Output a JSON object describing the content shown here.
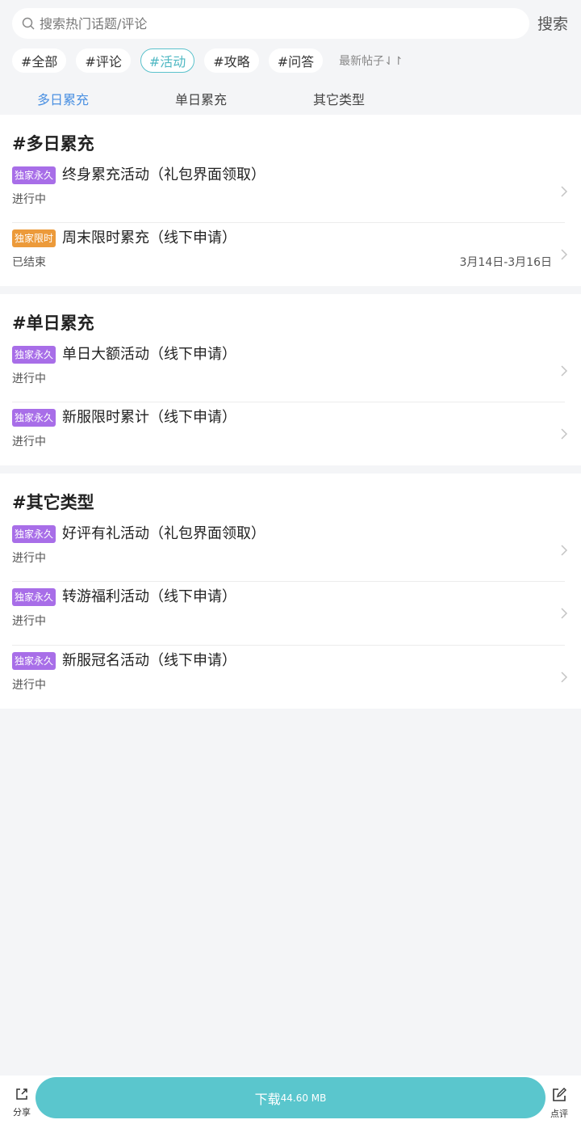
{
  "search": {
    "placeholder": "搜索热门话题/评论",
    "button": "搜索"
  },
  "tags": [
    "#全部",
    "#评论",
    "#活动",
    "#攻略",
    "#问答"
  ],
  "active_tag": "#活动",
  "sort_label": "最新帖子⇃↾",
  "subtabs": [
    "多日累充",
    "单日累充",
    "其它类型"
  ],
  "active_subtab": "多日累充",
  "sections": [
    {
      "title": "#多日累充",
      "items": [
        {
          "badge": "独家永久",
          "badge_color": "#a86ee8",
          "title": "终身累充活动（礼包界面领取）",
          "status": "进行中",
          "date": ""
        },
        {
          "badge": "独家限时",
          "badge_color": "#ec9a3a",
          "title": "周末限时累充（线下申请）",
          "status": "已结束",
          "date": "3月14日-3月16日"
        }
      ]
    },
    {
      "title": "#单日累充",
      "items": [
        {
          "badge": "独家永久",
          "badge_color": "#a86ee8",
          "title": "单日大额活动（线下申请）",
          "status": "进行中",
          "date": ""
        },
        {
          "badge": "独家永久",
          "badge_color": "#a86ee8",
          "title": "新服限时累计（线下申请）",
          "status": "进行中",
          "date": ""
        }
      ]
    },
    {
      "title": "#其它类型",
      "items": [
        {
          "badge": "独家永久",
          "badge_color": "#a86ee8",
          "title": "好评有礼活动（礼包界面领取）",
          "status": "进行中",
          "date": ""
        },
        {
          "badge": "独家永久",
          "badge_color": "#a86ee8",
          "title": "转游福利活动（线下申请）",
          "status": "进行中",
          "date": ""
        },
        {
          "badge": "独家永久",
          "badge_color": "#a86ee8",
          "title": "新服冠名活动（线下申请）",
          "status": "进行中",
          "date": ""
        }
      ]
    }
  ],
  "bottom": {
    "share": "分享",
    "download": "下载",
    "size": "44.60 MB",
    "review": "点评"
  },
  "colors": {
    "accent": "#5ac6cd",
    "tab_active": "#4a90e2",
    "badge_purple": "#a86ee8",
    "badge_orange": "#ec9a3a"
  }
}
